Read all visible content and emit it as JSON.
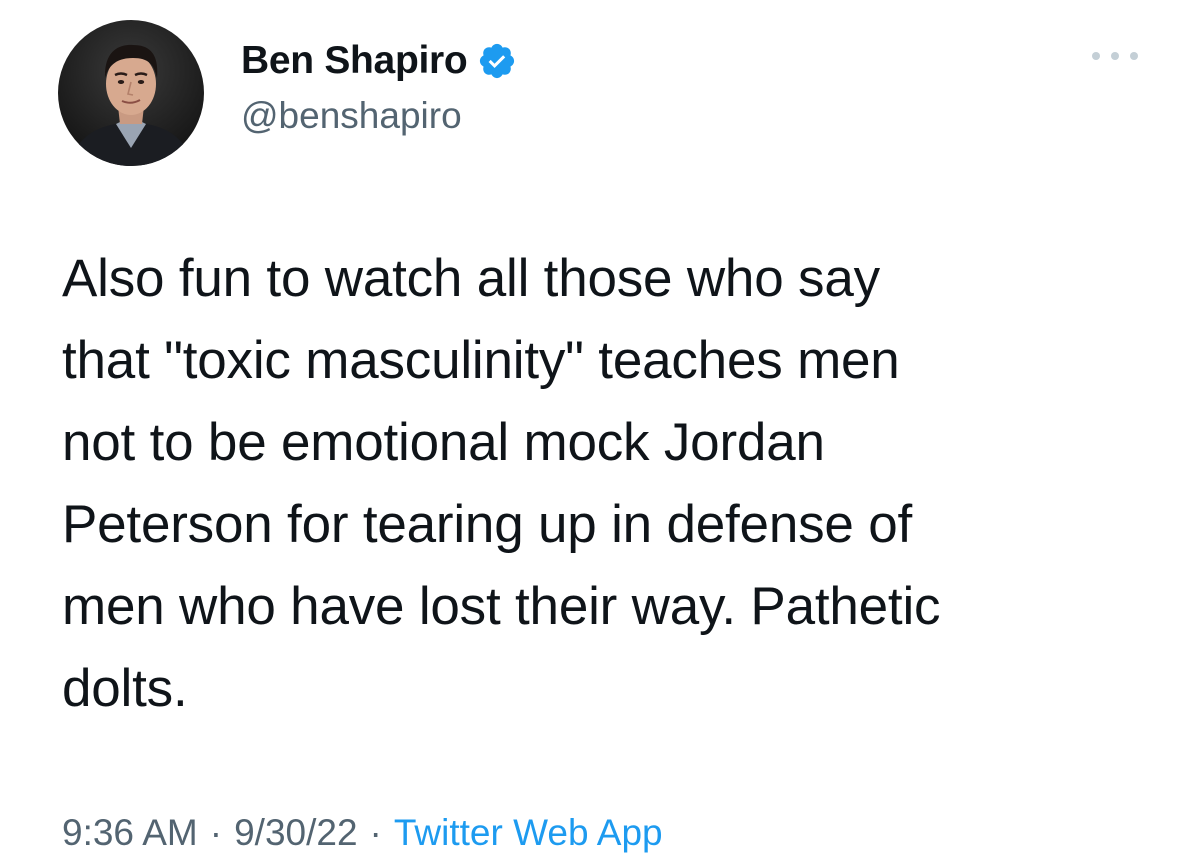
{
  "author": {
    "display_name": "Ben Shapiro",
    "handle": "@benshapiro",
    "verified": true,
    "verified_icon": "verified-badge-icon",
    "avatar_icon": "profile-photo"
  },
  "menu": {
    "more_icon": "more-options-icon"
  },
  "tweet": {
    "text": "Also fun to watch all those who say\nthat \"toxic masculinity\" teaches men\nnot to be emotional mock Jordan\nPeterson for tearing up in defense of\nmen who have lost their way. Pathetic\ndolts.",
    "time": "9:36 AM",
    "date": "9/30/22",
    "separator": "·",
    "source": "Twitter Web App"
  },
  "colors": {
    "text_primary": "#0f1419",
    "text_secondary": "#536471",
    "accent": "#1d9bf0",
    "background": "#ffffff"
  }
}
